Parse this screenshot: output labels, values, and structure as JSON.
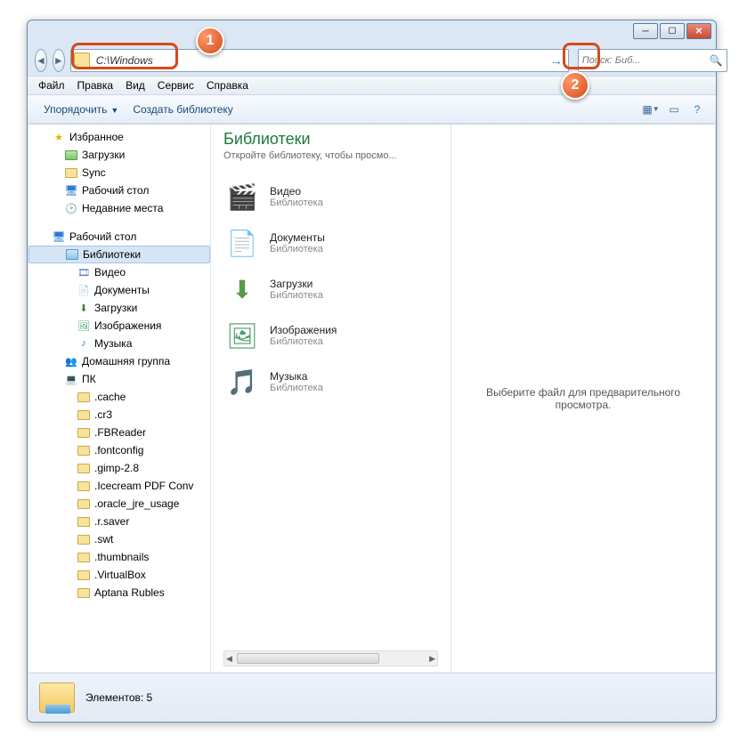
{
  "window": {
    "minimize_tip": "Свернуть",
    "maximize_tip": "Развернуть",
    "close_tip": "Закрыть"
  },
  "nav": {
    "address_value": "C:\\Windows",
    "search_placeholder": "Поиск: Биб..."
  },
  "menu": {
    "file": "Файл",
    "edit": "Правка",
    "view": "Вид",
    "tools": "Сервис",
    "help": "Справка"
  },
  "cmd": {
    "organize": "Упорядочить",
    "create_library": "Создать библиотеку"
  },
  "sidebar": {
    "favorites": "Избранное",
    "downloads_fav": "Загрузки",
    "sync": "Sync",
    "desktop_fav": "Рабочий стол",
    "recent": "Недавние места",
    "desktop": "Рабочий стол",
    "libraries": "Библиотеки",
    "video": "Видео",
    "documents": "Документы",
    "downloads": "Загрузки",
    "pictures": "Изображения",
    "music": "Музыка",
    "homegroup": "Домашняя группа",
    "pc": "ПК",
    "folders": {
      "f0": ".cache",
      "f1": ".cr3",
      "f2": ".FBReader",
      "f3": ".fontconfig",
      "f4": ".gimp-2.8",
      "f5": ".Icecream PDF Conv",
      "f6": ".oracle_jre_usage",
      "f7": ".r.saver",
      "f8": ".swt",
      "f9": ".thumbnails",
      "f10": ".VirtualBox",
      "f11": "Aptana Rubles"
    }
  },
  "main": {
    "title": "Библиотеки",
    "subtitle": "Откройте библиотеку, чтобы просмо...",
    "lib_type": "Библиотека",
    "items": {
      "video": "Видео",
      "documents": "Документы",
      "downloads": "Загрузки",
      "pictures": "Изображения",
      "music": "Музыка"
    }
  },
  "preview": {
    "text": "Выберите файл для предварительного просмотра."
  },
  "status": {
    "count_label": "Элементов: 5"
  },
  "markers": {
    "m1": "1",
    "m2": "2"
  }
}
